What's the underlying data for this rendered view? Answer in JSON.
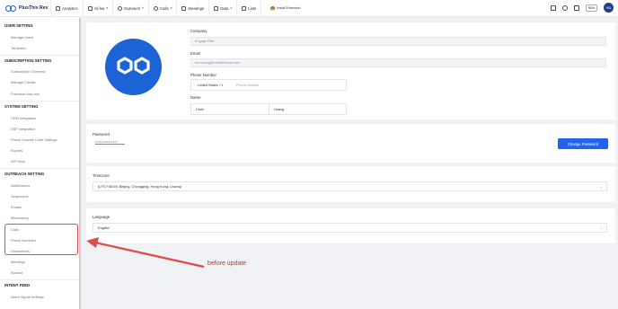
{
  "app": {
    "name": "PlusThis Rev",
    "brand_color": "#1f5fd1"
  },
  "topnav": [
    {
      "label": "Analytics",
      "icon": "analytics-icon",
      "caret": false
    },
    {
      "label": "All hw",
      "icon": "list-icon",
      "caret": true
    },
    {
      "label": "Outreach",
      "icon": "outreach-icon",
      "caret": true
    },
    {
      "label": "Calls",
      "icon": "phone-icon",
      "caret": true
    },
    {
      "label": "Meetings",
      "icon": "calendar-icon",
      "caret": false
    },
    {
      "label": "Data",
      "icon": "data-icon",
      "caret": true
    },
    {
      "label": "Lists",
      "icon": "lists-icon",
      "caret": false
    }
  ],
  "extension": {
    "label": "Install Extension"
  },
  "topright": {
    "lang": "NBA",
    "avatar": "HD"
  },
  "sidebar": {
    "sections": [
      {
        "title": "USER SETTING",
        "items": [
          "Manage Users",
          "Territories"
        ]
      },
      {
        "title": "SUBSCRIPTION SETTING",
        "items": [
          "Subscription Overview",
          "Manage Credits",
          "Purchase Add-ons"
        ]
      },
      {
        "title": "SYSTEM SETTING",
        "items": [
          "CRM Integration",
          "ESP Integration",
          "Phone Country Code Settings",
          "Exports",
          "API Keys"
        ]
      },
      {
        "title": "OUTREACH SETTING",
        "items": [
          "Notifications",
          "Sequences",
          "Emails",
          "Mixmastery",
          "Calls",
          "Phone Numbers",
          "Dispositions",
          "Meetings",
          "Booked"
        ]
      },
      {
        "title": "INTENT FEED",
        "items": [
          "Intent Signal Settings"
        ]
      }
    ]
  },
  "profile": {
    "company_label": "Company",
    "company_value": "Engage Elite",
    "email_label": "Email",
    "email_value": "ms.huang@multiaircloud.com",
    "phone_label": "Phone Number",
    "phone_country": "United States +1",
    "phone_placeholder": "Phone Number",
    "name_label": "Name",
    "first_name": "Chris",
    "last_name": "Huang"
  },
  "password": {
    "label": "Password",
    "masked": "•••••••••••••••",
    "button": "Change Password"
  },
  "timezone": {
    "label": "Timezone",
    "value": "(UTC+08:00) Beijing, Chongqing, Hong Kong, Urumqi"
  },
  "language": {
    "label": "Language",
    "value": "English"
  },
  "annotation": {
    "text": "before update",
    "color": "#e04b4b"
  }
}
